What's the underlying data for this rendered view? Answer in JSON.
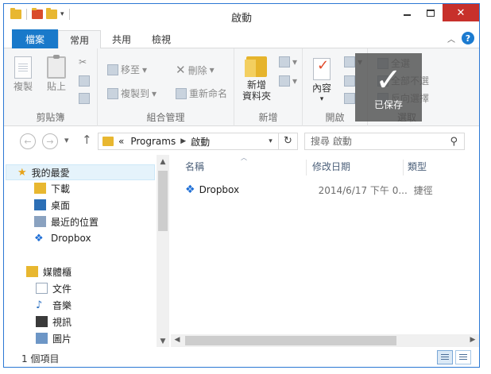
{
  "window": {
    "title": "啟動",
    "minimize": "",
    "maximize": "",
    "close": "✕"
  },
  "tabs": {
    "file": "檔案",
    "items": [
      "常用",
      "共用",
      "檢視"
    ]
  },
  "ribbon": {
    "clipboard": {
      "copy": "複製",
      "paste": "貼上",
      "label": "剪貼簿"
    },
    "organize": {
      "move_to": "移至",
      "copy_to": "複製到",
      "delete": "刪除",
      "rename": "重新命名",
      "label": "組合管理"
    },
    "new": {
      "new_folder_line1": "新增",
      "new_folder_line2": "資料夾",
      "label": "新增"
    },
    "open": {
      "properties": "內容",
      "label": "開啟"
    },
    "select": {
      "select_all": "全選",
      "select_none": "全部不選",
      "invert": "反向選擇",
      "label": "選取"
    }
  },
  "saved_overlay": {
    "check": "✓",
    "text": "已保存"
  },
  "address": {
    "prefix": "«",
    "crumbs": [
      "Programs",
      "啟動"
    ],
    "dropdown": "▾",
    "refresh": "↻"
  },
  "search": {
    "placeholder": "搜尋 啟動",
    "icon": "search-icon"
  },
  "nav": {
    "back": "←",
    "forward": "→",
    "recent": "▾",
    "up": "↑"
  },
  "navpane": {
    "favorites": "我的最愛",
    "items_fav": [
      "下載",
      "桌面",
      "最近的位置",
      "Dropbox"
    ],
    "libraries": "媒體櫃",
    "items_lib": [
      "文件",
      "音樂",
      "視訊",
      "圖片"
    ]
  },
  "columns": {
    "name": "名稱",
    "modified": "修改日期",
    "type": "類型"
  },
  "files": [
    {
      "name": "Dropbox",
      "modified": "2014/6/17 下午 0...",
      "type": "捷徑"
    }
  ],
  "status": {
    "count": "1 個項目"
  },
  "colors": {
    "accent": "#1979ca",
    "close": "#c7302b",
    "folder": "#e8b730"
  }
}
